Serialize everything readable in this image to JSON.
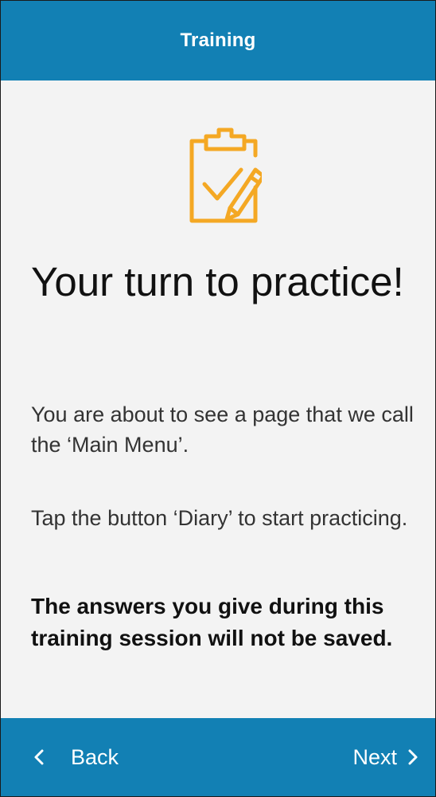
{
  "header": {
    "title": "Training"
  },
  "main": {
    "icon": "clipboard-check-pencil-icon",
    "heading": "Your turn to practice!",
    "paragraph1": "You are about to see a page that we call the ‘Main Menu’.",
    "paragraph2": "Tap the button ‘Diary’ to start practicing.",
    "notice": "The answers you give during this training session will not be saved."
  },
  "footer": {
    "back_label": "Back",
    "next_label": "Next"
  },
  "colors": {
    "bar": "#1280b4",
    "background": "#f3f3f3",
    "icon": "#f4a824"
  }
}
